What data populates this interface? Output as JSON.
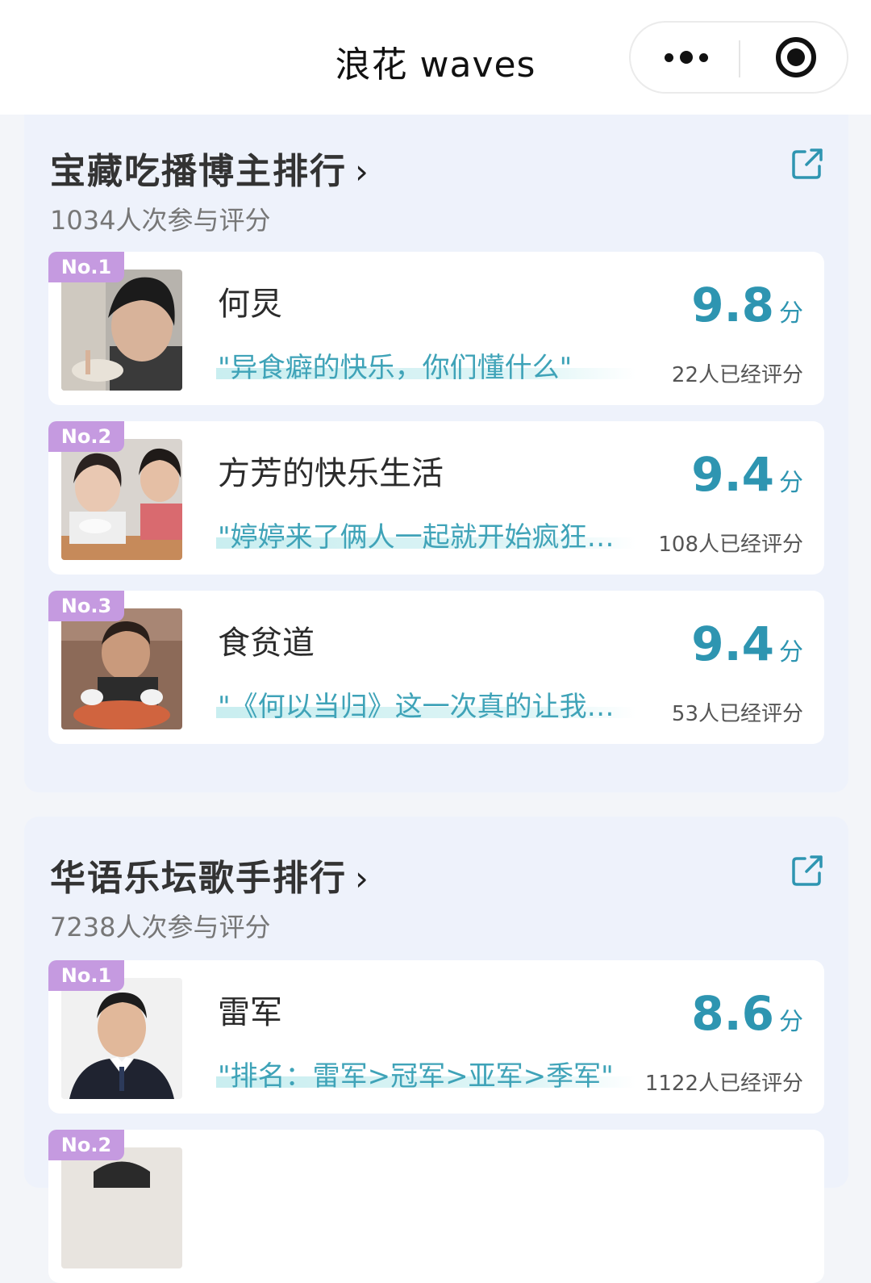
{
  "app": {
    "title": "浪花 waves"
  },
  "sections": [
    {
      "title": "宝藏吃播博主排行",
      "chevron": "›",
      "participants": "1034人次参与评分",
      "items": [
        {
          "rank": "No.1",
          "name": "何炅",
          "quote": "\"异食癖的快乐，你们懂什么\"",
          "score": "9.8",
          "unit": "分",
          "raters": "22人已经评分"
        },
        {
          "rank": "No.2",
          "name": "方芳的快乐生活",
          "quote": "\"婷婷来了俩人一起就开始疯狂…",
          "score": "9.4",
          "unit": "分",
          "raters": "108人已经评分"
        },
        {
          "rank": "No.3",
          "name": "食贫道",
          "quote": "\"《何以当归》这一次真的让我…",
          "score": "9.4",
          "unit": "分",
          "raters": "53人已经评分"
        }
      ]
    },
    {
      "title": "华语乐坛歌手排行",
      "chevron": "›",
      "participants": "7238人次参与评分",
      "items": [
        {
          "rank": "No.1",
          "name": "雷军",
          "quote": "\"排名：雷军>冠军>亚军>季军\"",
          "score": "8.6",
          "unit": "分",
          "raters": "1122人已经评分"
        },
        {
          "rank": "No.2",
          "name": "",
          "quote": "",
          "score": "",
          "unit": "",
          "raters": ""
        }
      ]
    }
  ],
  "colors": {
    "accent": "#2e95b1",
    "quote": "#3fa3b8",
    "badge": "#c59ae0",
    "section_bg": "#eef2fb"
  }
}
